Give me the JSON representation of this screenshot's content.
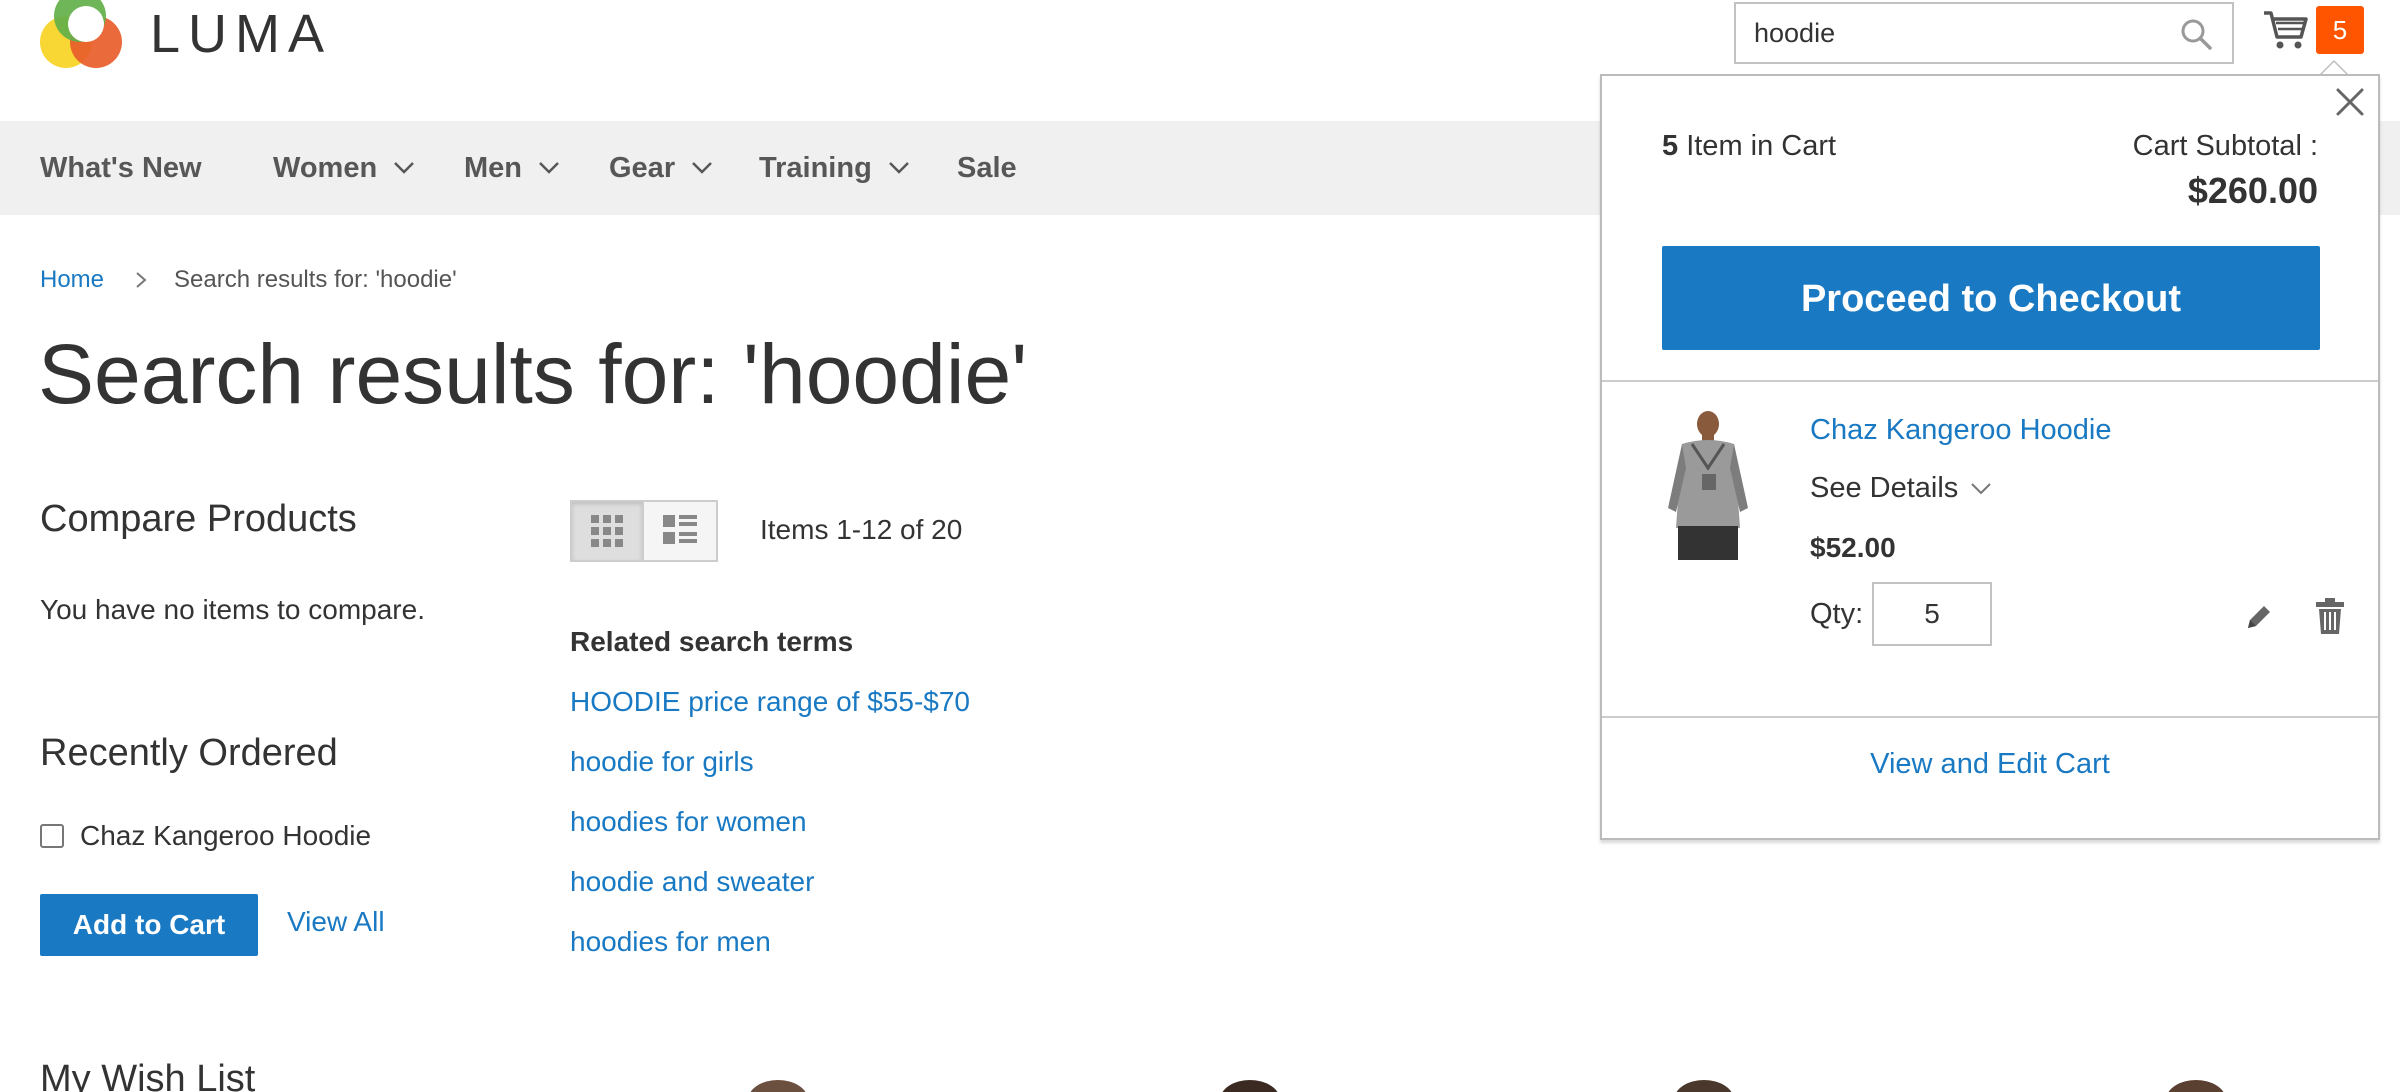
{
  "header": {
    "logo_text": "LUMA",
    "search_value": "hoodie",
    "cart_count": "5",
    "colors": {
      "accent": "#1979c3",
      "badge": "#ff5501"
    }
  },
  "nav": {
    "items": [
      {
        "label": "What's New"
      },
      {
        "label": "Women"
      },
      {
        "label": "Men"
      },
      {
        "label": "Gear"
      },
      {
        "label": "Training"
      },
      {
        "label": "Sale"
      }
    ]
  },
  "breadcrumb": {
    "home": "Home",
    "current": "Search results for: 'hoodie'"
  },
  "page_title": "Search results for: 'hoodie'",
  "sidebar": {
    "compare_title": "Compare Products",
    "compare_empty": "You have no items to compare.",
    "recent_title": "Recently Ordered",
    "recent_item": "Chaz Kangeroo Hoodie",
    "add_to_cart": "Add to Cart",
    "view_all": "View All",
    "wishlist_title": "My Wish List"
  },
  "toolbar": {
    "amount": "Items 1-12 of 20"
  },
  "related": {
    "title": "Related search terms",
    "terms": [
      "HOODIE price range of $55-$70",
      "hoodie for girls",
      "hoodies for women",
      "hoodie and sweater",
      "hoodies for men"
    ]
  },
  "minicart": {
    "count_num": "5",
    "count_text": " Item in Cart",
    "subtotal_label": "Cart Subtotal :",
    "subtotal": "$260.00",
    "checkout": "Proceed to Checkout",
    "item": {
      "name": "Chaz Kangeroo Hoodie",
      "details": "See Details",
      "price": "$52.00",
      "qty_label": "Qty:",
      "qty": "5"
    },
    "view_edit": "View and Edit Cart"
  }
}
